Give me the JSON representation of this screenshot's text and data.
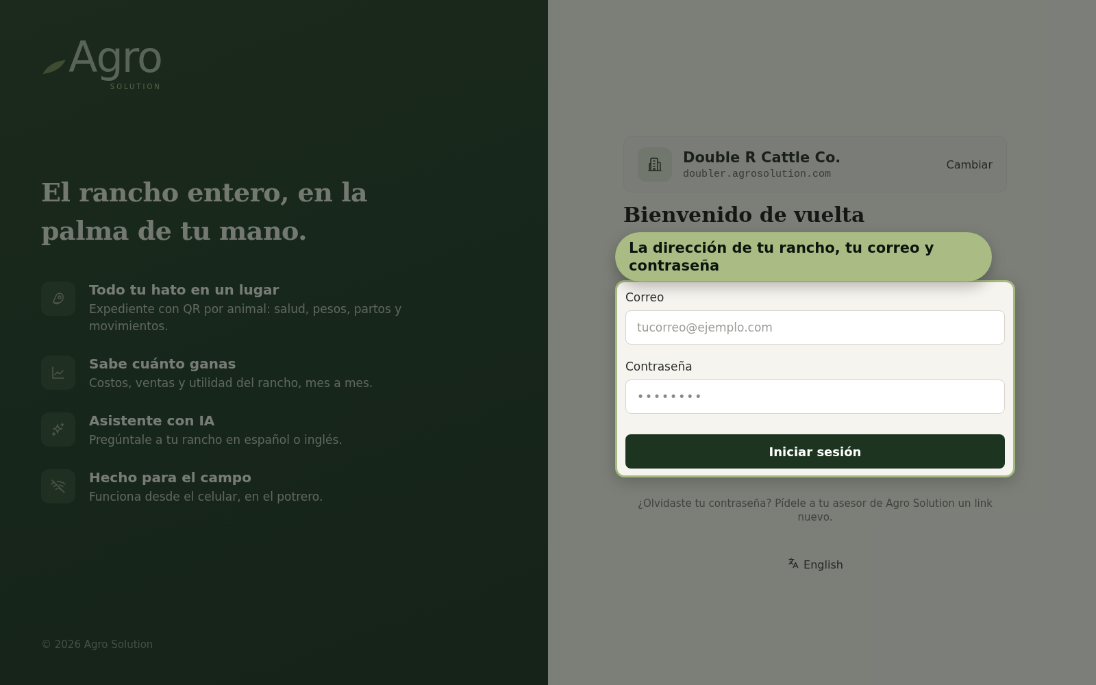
{
  "brand": {
    "name": "Agro",
    "tagline": "SOLUTION"
  },
  "headline": "El rancho entero, en la palma de tu mano.",
  "features": [
    {
      "kind": "steak",
      "title": "Todo tu hato en un lugar",
      "description": "Expediente con QR por animal: salud, pesos, partos y movimientos."
    },
    {
      "kind": "chart",
      "title": "Sabe cuánto ganas",
      "description": "Costos, ventas y utilidad del rancho, mes a mes."
    },
    {
      "kind": "sparkles",
      "title": "Asistente con IA",
      "description": "Pregúntale a tu rancho en español o inglés."
    },
    {
      "kind": "offline",
      "title": "Hecho para el campo",
      "description": "Funciona desde el celular, en el potrero."
    }
  ],
  "copyright": "© 2026 Agro Solution",
  "tenant": {
    "name": "Double R Cattle Co.",
    "domain": "doubler.agrosolution.com",
    "change": "Cambiar"
  },
  "heading": "Bienvenido de vuelta",
  "tour_tip": "La dirección de tu rancho, tu correo y contraseña",
  "form": {
    "fields": [
      {
        "label": "Correo",
        "placeholder": "tucorreo@ejemplo.com"
      },
      {
        "label": "Contraseña",
        "value": "••••••••"
      }
    ],
    "submit": "Iniciar sesión"
  },
  "forgot": "¿Olvidaste tu contraseña? Pídele a tu asesor de Agro Solution un link nuevo.",
  "language": "English"
}
